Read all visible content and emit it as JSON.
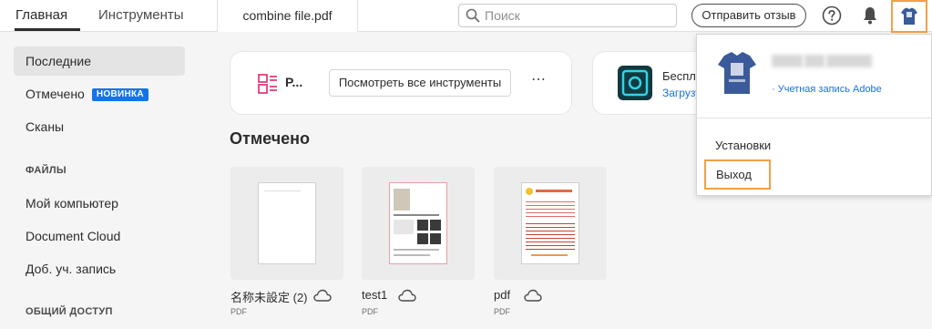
{
  "tabs": [
    {
      "label": "Главная",
      "active": true
    },
    {
      "label": "Инструменты",
      "active": false
    }
  ],
  "document_tab": {
    "label": "combine file.pdf"
  },
  "search": {
    "placeholder": "Поиск",
    "value": ""
  },
  "feedback_button": {
    "label": "Отправить отзыв"
  },
  "icons": {
    "help": "help-icon",
    "notifications": "bell-icon",
    "account": "avatar-icon"
  },
  "highlight_color": "#f0a04a",
  "accent_color": "#1473e6",
  "sidebar": {
    "items": [
      {
        "label": "Последние",
        "selected": true
      },
      {
        "label": "Отмечено",
        "badge": "НОВИНКА"
      },
      {
        "label": "Сканы"
      }
    ],
    "files_heading": "ФАЙЛЫ",
    "file_items": [
      {
        "label": "Мой компьютер"
      },
      {
        "label": "Document Cloud"
      },
      {
        "label": "Доб. уч. запись"
      }
    ],
    "sharing_heading": "ОБЩИЙ ДОСТУП"
  },
  "tools_card": {
    "tool_name": "P...",
    "view_all_button": "Посмотреть все инструменты",
    "more_icon": "⋯"
  },
  "promo_card": {
    "title": "Беспла",
    "link": "Загрузу"
  },
  "section_title": "Отмечено",
  "files": [
    {
      "name": "名称未設定 (2)",
      "type": "PDF"
    },
    {
      "name": "test1",
      "type": "PDF"
    },
    {
      "name": "pdf",
      "type": "PDF"
    }
  ],
  "account_menu": {
    "account_link": "· Учетная запись Adobe",
    "items": [
      {
        "label": "Установки"
      },
      {
        "label": "Выход",
        "highlighted": true
      }
    ]
  }
}
